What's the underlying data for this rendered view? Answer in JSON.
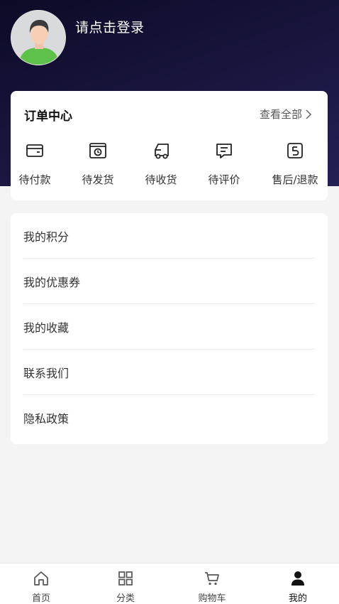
{
  "header": {
    "login_text": "请点击登录"
  },
  "orders": {
    "title": "订单中心",
    "view_all": "查看全部",
    "items": [
      {
        "label": "待付款",
        "icon": "wallet-icon"
      },
      {
        "label": "待发货",
        "icon": "box-icon"
      },
      {
        "label": "待收货",
        "icon": "truck-icon"
      },
      {
        "label": "待评价",
        "icon": "comment-icon"
      },
      {
        "label": "售后/退款",
        "icon": "refund-icon"
      }
    ]
  },
  "menu": {
    "items": [
      {
        "label": "我的积分"
      },
      {
        "label": "我的优惠券"
      },
      {
        "label": "我的收藏"
      },
      {
        "label": "联系我们"
      },
      {
        "label": "隐私政策"
      }
    ]
  },
  "tabbar": {
    "items": [
      {
        "label": "首页",
        "icon": "home-icon"
      },
      {
        "label": "分类",
        "icon": "grid-icon"
      },
      {
        "label": "购物车",
        "icon": "cart-icon"
      },
      {
        "label": "我的",
        "icon": "user-icon"
      }
    ],
    "active": "我的"
  }
}
